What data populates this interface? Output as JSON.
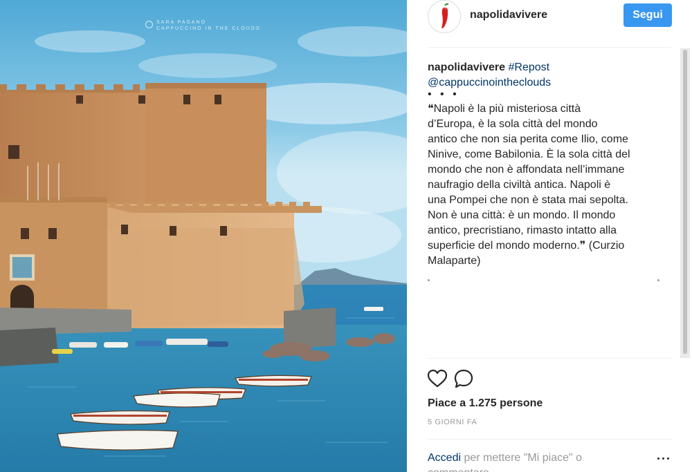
{
  "post": {
    "username": "napolidavivere",
    "follow_label": "Segui",
    "caption_user": "napolidavivere",
    "hashtag": "#Repost",
    "mention": "@cappuccinointheclouds",
    "dots": "• • •",
    "quote_lines": [
      "❝Napoli è la più misteriosa città",
      "d’Europa, è la sola città del mondo",
      "antico che non sia perita come Ilio, come",
      "Ninive, come Babilonia. È la sola città del",
      "mondo che non è affondata nell’immane",
      "naufragio della civiltà antica. Napoli è",
      "una Pompei che non è stata mai sepolta.",
      "Non è una città: è un mondo. Il mondo",
      "antico, precristiano, rimasto intatto alla",
      "superficie del mondo moderno.❞ (Curzio",
      "Malaparte)"
    ],
    "likes": "Piace a 1.275 persone",
    "timestamp": "5 GIORNI FA",
    "login_link": "Accedi",
    "login_text": " per mettere \"Mi piace\" o",
    "login_text2": "commentare"
  },
  "photo": {
    "watermark_line1": "SARA PAGANO",
    "watermark_line2": "CAPPUCCINO IN THE CLOUDS"
  },
  "icons": {
    "like": "heart-outline-icon",
    "comment": "speech-bubble-icon",
    "avatar": "red-chili-pepper-logo",
    "more": "ellipsis-icon"
  },
  "colors": {
    "follow_button": "#3897f0",
    "link": "#003569",
    "muted": "#999999"
  }
}
